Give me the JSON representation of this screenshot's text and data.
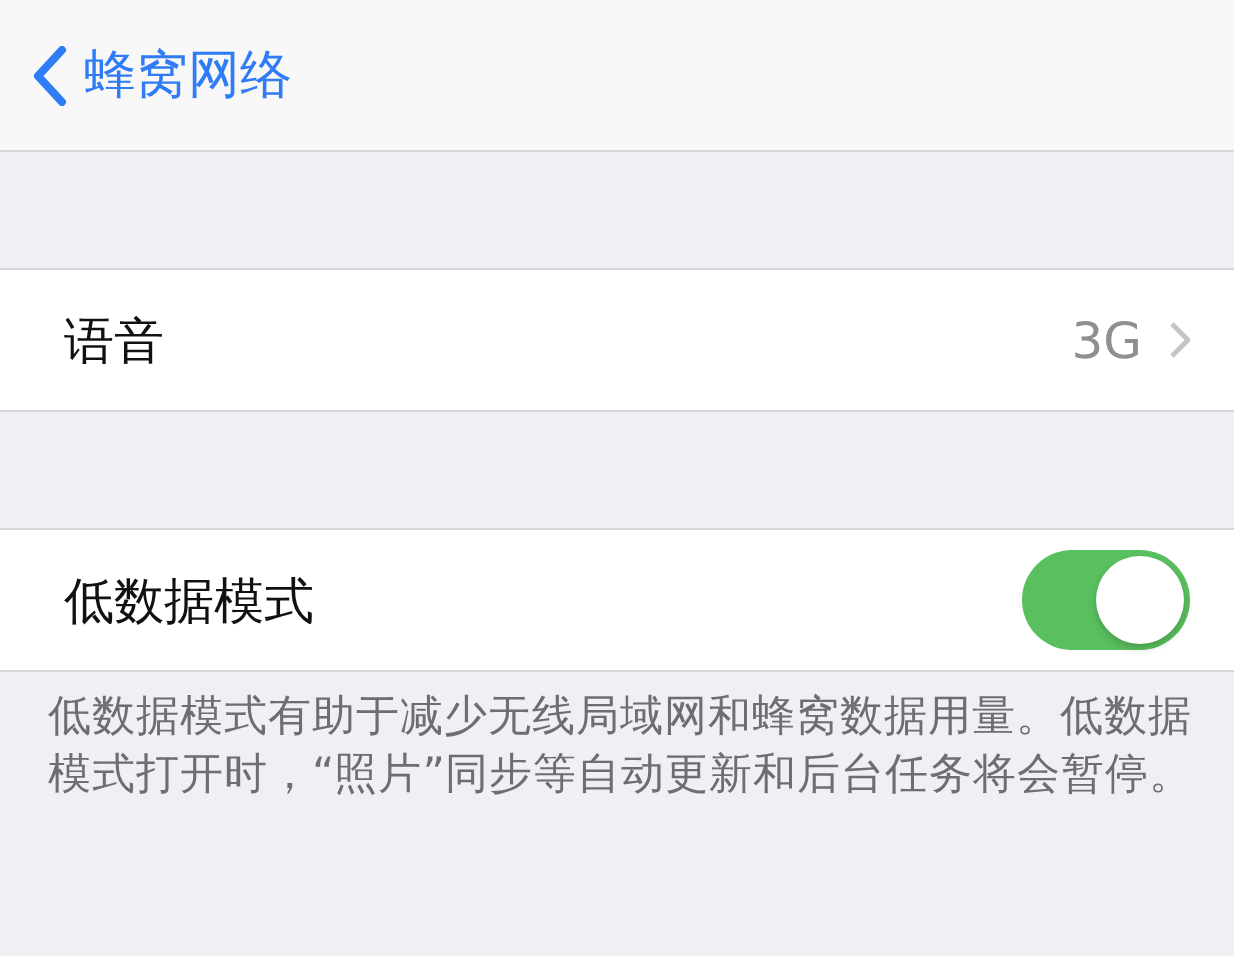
{
  "nav": {
    "back_label": "蜂窝网络"
  },
  "rows": [
    {
      "kind": "detail",
      "label": "语音",
      "value": "3G"
    },
    {
      "kind": "toggle",
      "label": "低数据模式",
      "on": true
    }
  ],
  "footer": "低数据模式有助于减少无线局域网和蜂窝数据用量。低数据模式打开时，“照片”同步等自动更新和后台任务将会暂停。"
}
